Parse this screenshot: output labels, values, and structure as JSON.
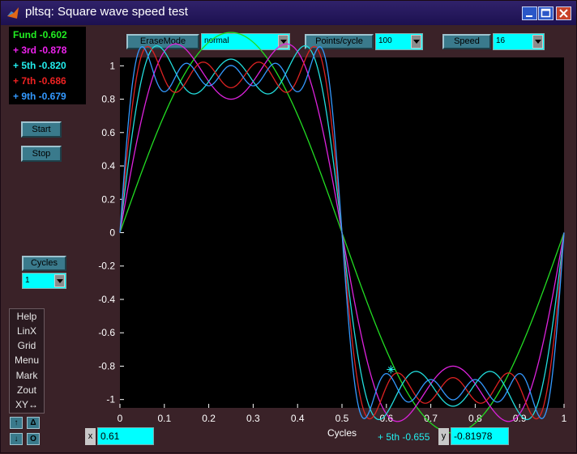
{
  "window": {
    "title": "pltsq: Square wave speed test"
  },
  "legend": [
    {
      "label": "Fund -0.602",
      "color": "#22ee22"
    },
    {
      "label": "+ 3rd -0.878",
      "color": "#ee22ee"
    },
    {
      "label": "+ 5th -0.820",
      "color": "#22eeee"
    },
    {
      "label": "+ 7th -0.686",
      "color": "#ee2222"
    },
    {
      "label": "+ 9th -0.679",
      "color": "#3399ff"
    }
  ],
  "controls": {
    "start_label": "Start",
    "stop_label": "Stop",
    "cycles_label": "Cycles",
    "cycles_value": "1",
    "erase_label": "EraseMode",
    "erase_value": "normal",
    "points_label": "Points/cycle",
    "points_value": "100",
    "speed_label": "Speed",
    "speed_value": "16"
  },
  "menu": [
    "Help",
    "LinX",
    "Grid",
    "Menu",
    "Mark",
    "Zout",
    "XY↔"
  ],
  "nav_buttons": {
    "up": "↑",
    "delta": "Δ",
    "down": "↓",
    "o": "O"
  },
  "readout": {
    "x_label": "x",
    "x_value": "0.61",
    "series_text": "+ 5th -0.655",
    "y_label": "y",
    "y_value": "-0.81978"
  },
  "chart_data": {
    "type": "line",
    "xlabel": "Cycles",
    "ylabel": "",
    "xlim": [
      0,
      1
    ],
    "ylim": [
      -1.05,
      1.05
    ],
    "xticks": [
      "0",
      "0.1",
      "0.2",
      "0.3",
      "0.4",
      "0.5",
      "0.6",
      "0.7",
      "0.8",
      "0.9",
      "1"
    ],
    "yticks": [
      "1",
      "0.8",
      "0.6",
      "0.4",
      "0.2",
      "0",
      "-0.2",
      "-0.4",
      "-0.6",
      "-0.8",
      "-1"
    ],
    "grid": false,
    "series": [
      {
        "name": "Fund",
        "harmonics": 1,
        "color": "#22dd22"
      },
      {
        "name": "3rd",
        "harmonics": 3,
        "color": "#dd22dd"
      },
      {
        "name": "5th",
        "harmonics": 5,
        "color": "#22dddd"
      },
      {
        "name": "7th",
        "harmonics": 7,
        "color": "#dd2222"
      },
      {
        "name": "9th",
        "harmonics": 9,
        "color": "#3399ff"
      }
    ],
    "marker": {
      "x": 0.61,
      "y": -0.81978,
      "series": "5th"
    }
  },
  "colors": {
    "accent": "#00ffff",
    "plot_bg": "#000000",
    "frame": "#3a2228"
  }
}
